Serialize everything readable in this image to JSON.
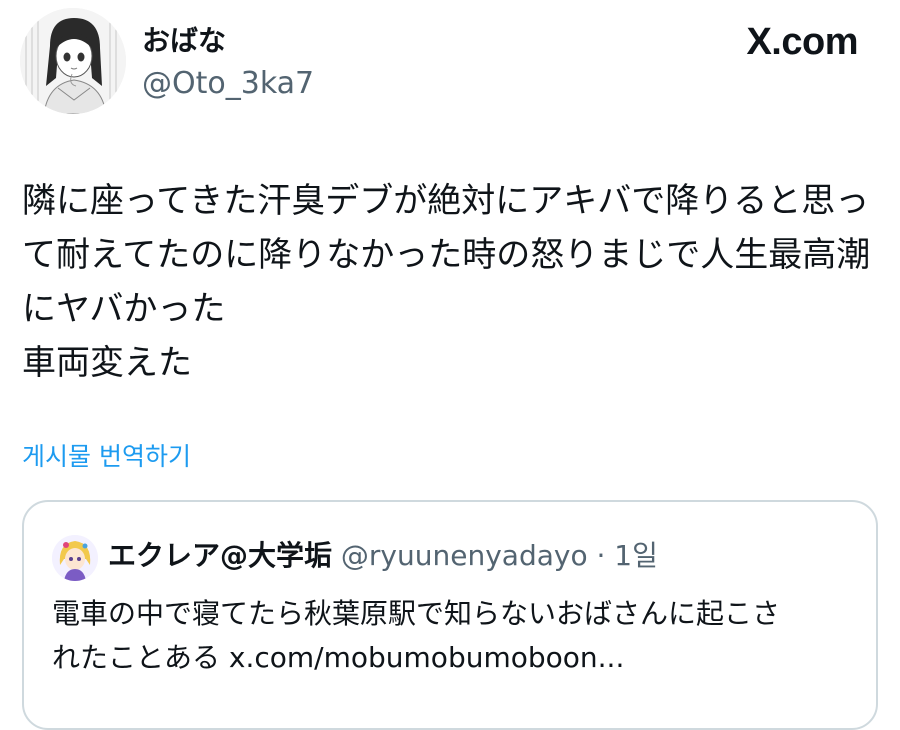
{
  "author": {
    "display_name": "おばな",
    "handle": "@Oto_3ka7",
    "avatar_icon": "manga-girl-avatar-icon"
  },
  "brand": {
    "text": "X.com"
  },
  "tweet": {
    "lines": [
      "隣に座ってきた汗臭デブが絶対にアキバで降りると思っ",
      "て耐えてたのに降りなかった時の怒りまじで人生最高潮",
      "にヤバかった",
      "車両変えた"
    ],
    "translate_label": "게시물 번역하기"
  },
  "quote": {
    "display_name": "エクレア@大学垢",
    "handle": "@ryuunenyadayo",
    "separator": "·",
    "time": "1일",
    "lines": [
      "電車の中で寝てたら秋葉原駅で知らないおばさんに起こさ",
      "れたことある x.com/mobumobumoboon..."
    ],
    "avatar_icon": "anime-character-avatar-icon"
  },
  "colors": {
    "text": "#0f1419",
    "secondary": "#536471",
    "link": "#1d9bf0",
    "border": "#cfd9de"
  }
}
